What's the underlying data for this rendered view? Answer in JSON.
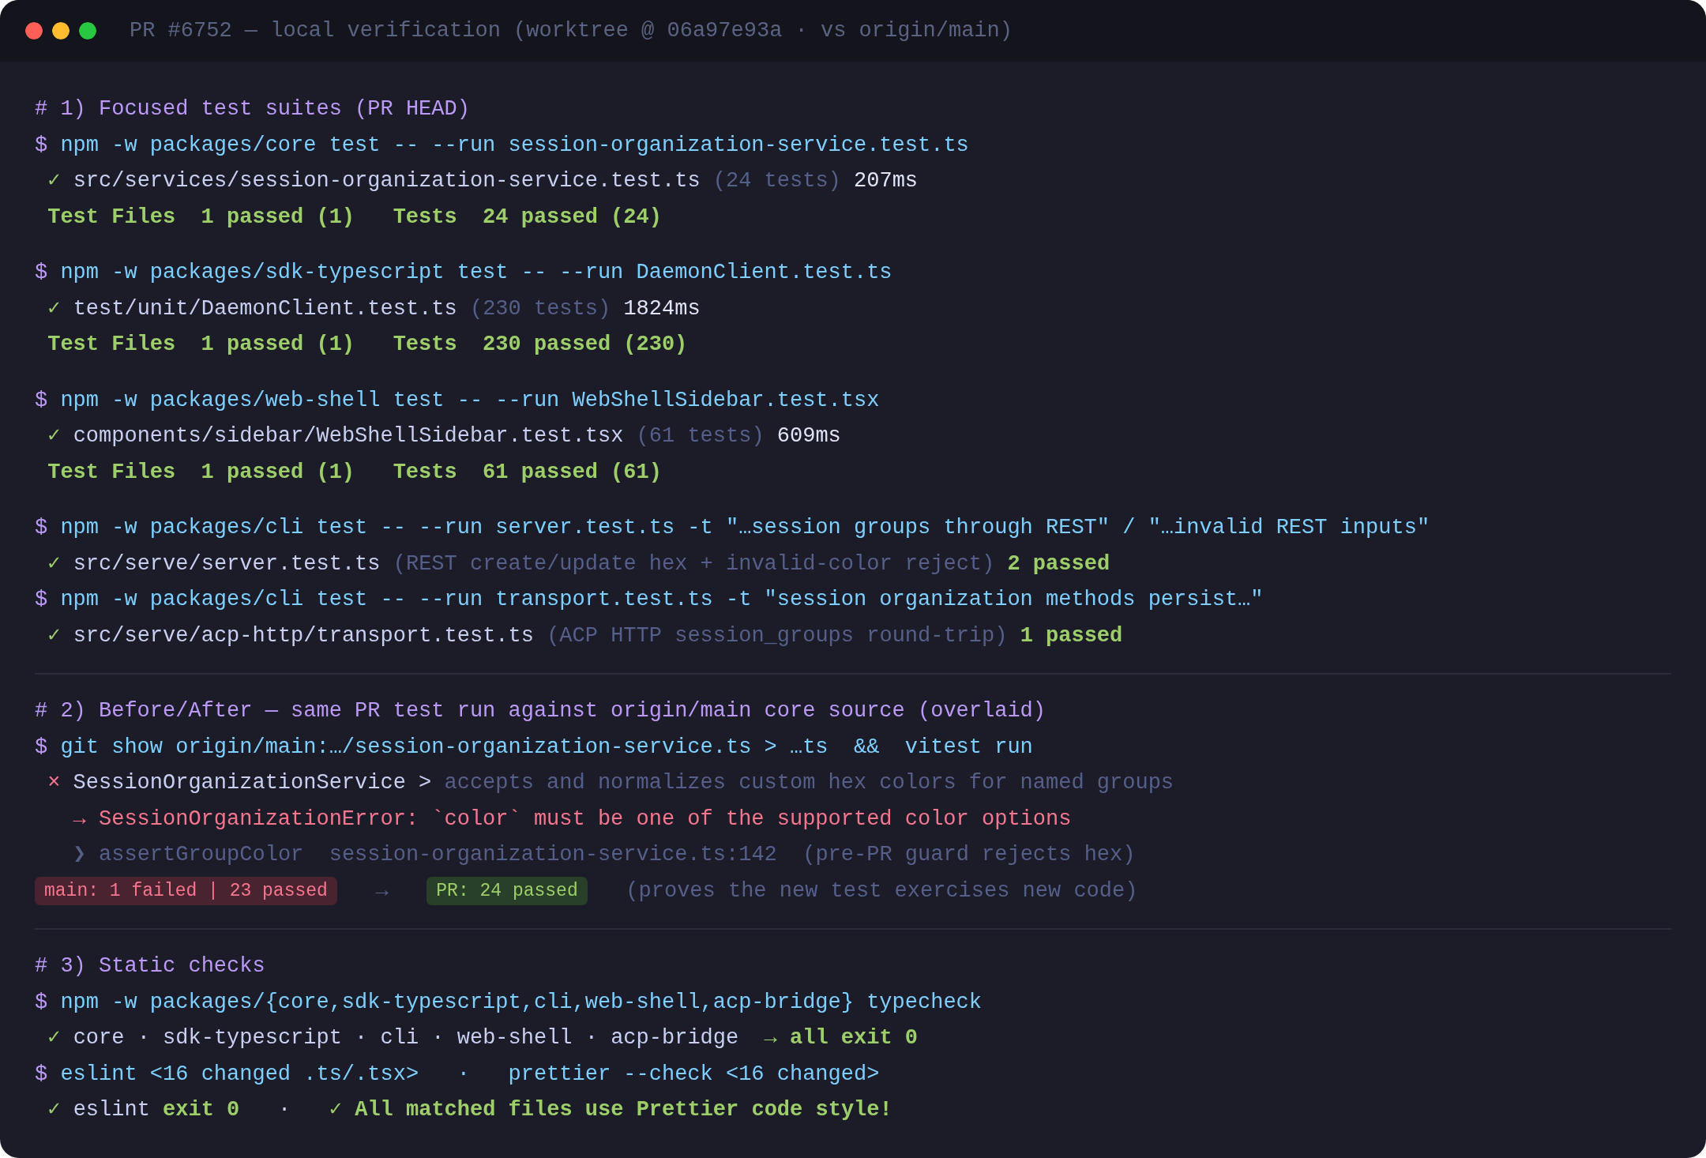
{
  "window": {
    "title": "PR #6752 — local verification (worktree @ 06a97e93a · vs origin/main)"
  },
  "sections": [
    {
      "blocks": [
        {
          "lines": [
            {
              "kind": "command",
              "segments": [
                {
                  "kind": "comment",
                  "text": "# 1) Focused test suites (PR HEAD)"
                }
              ]
            },
            {
              "kind": "command",
              "segments": [
                {
                  "kind": "prompt",
                  "text": "$"
                },
                {
                  "kind": "cmd",
                  "text": " npm -w packages/core test -- --run session-organization-service.test.ts"
                }
              ]
            },
            {
              "kind": "result",
              "segments": [
                {
                  "kind": "check",
                  "text": "✓"
                },
                {
                  "kind": "path",
                  "text": " src/services/session-organization-service.test.ts"
                },
                {
                  "kind": "muted",
                  "text": " (24 tests)"
                },
                {
                  "kind": "timing",
                  "text": " 207ms"
                }
              ]
            },
            {
              "kind": "result",
              "segments": [
                {
                  "kind": "pass",
                  "text": "Test Files  1 passed (1)   Tests  24 passed (24)"
                }
              ]
            }
          ]
        },
        {
          "lines": [
            {
              "kind": "command",
              "segments": [
                {
                  "kind": "prompt",
                  "text": "$"
                },
                {
                  "kind": "cmd",
                  "text": " npm -w packages/sdk-typescript test -- --run DaemonClient.test.ts"
                }
              ]
            },
            {
              "kind": "result",
              "segments": [
                {
                  "kind": "check",
                  "text": "✓"
                },
                {
                  "kind": "path",
                  "text": " test/unit/DaemonClient.test.ts"
                },
                {
                  "kind": "muted",
                  "text": " (230 tests)"
                },
                {
                  "kind": "timing",
                  "text": " 1824ms"
                }
              ]
            },
            {
              "kind": "result",
              "segments": [
                {
                  "kind": "pass",
                  "text": "Test Files  1 passed (1)   Tests  230 passed (230)"
                }
              ]
            }
          ]
        },
        {
          "lines": [
            {
              "kind": "command",
              "segments": [
                {
                  "kind": "prompt",
                  "text": "$"
                },
                {
                  "kind": "cmd",
                  "text": " npm -w packages/web-shell test -- --run WebShellSidebar.test.tsx"
                }
              ]
            },
            {
              "kind": "result",
              "segments": [
                {
                  "kind": "check",
                  "text": "✓"
                },
                {
                  "kind": "path",
                  "text": " components/sidebar/WebShellSidebar.test.tsx"
                },
                {
                  "kind": "muted",
                  "text": " (61 tests)"
                },
                {
                  "kind": "timing",
                  "text": " 609ms"
                }
              ]
            },
            {
              "kind": "result",
              "segments": [
                {
                  "kind": "pass",
                  "text": "Test Files  1 passed (1)   Tests  61 passed (61)"
                }
              ]
            }
          ]
        },
        {
          "lines": [
            {
              "kind": "command",
              "segments": [
                {
                  "kind": "prompt",
                  "text": "$"
                },
                {
                  "kind": "cmd",
                  "text": " npm -w packages/cli test -- --run server.test.ts -t \"…session groups through REST\" / \"…invalid REST inputs\""
                }
              ]
            },
            {
              "kind": "result",
              "segments": [
                {
                  "kind": "check",
                  "text": "✓"
                },
                {
                  "kind": "path",
                  "text": " src/serve/server.test.ts"
                },
                {
                  "kind": "muted",
                  "text": " (REST create/update hex + invalid-color reject)"
                },
                {
                  "kind": "pass",
                  "text": " 2 passed"
                }
              ]
            },
            {
              "kind": "command",
              "segments": [
                {
                  "kind": "prompt",
                  "text": "$"
                },
                {
                  "kind": "cmd",
                  "text": " npm -w packages/cli test -- --run transport.test.ts -t \"session organization methods persist…\""
                }
              ]
            },
            {
              "kind": "result",
              "segments": [
                {
                  "kind": "check",
                  "text": "✓"
                },
                {
                  "kind": "path",
                  "text": " src/serve/acp-http/transport.test.ts"
                },
                {
                  "kind": "muted",
                  "text": " (ACP HTTP session_groups round-trip)"
                },
                {
                  "kind": "pass",
                  "text": " 1 passed"
                }
              ]
            }
          ]
        }
      ]
    },
    {
      "blocks": [
        {
          "lines": [
            {
              "kind": "command",
              "segments": [
                {
                  "kind": "comment",
                  "text": "# 2) Before/After — same PR test run against origin/main core source (overlaid)"
                }
              ]
            },
            {
              "kind": "command",
              "segments": [
                {
                  "kind": "prompt",
                  "text": "$"
                },
                {
                  "kind": "cmd",
                  "text": " git show origin/main:…/session-organization-service.ts > …ts  &&  vitest run"
                }
              ]
            },
            {
              "kind": "result",
              "segments": [
                {
                  "kind": "cross",
                  "text": "×"
                },
                {
                  "kind": "path",
                  "text": " SessionOrganizationService >"
                },
                {
                  "kind": "muted",
                  "text": " accepts and normalizes custom hex colors for named groups"
                }
              ]
            },
            {
              "kind": "detail",
              "segments": [
                {
                  "kind": "error",
                  "text": "→ SessionOrganizationError: `color` must be one of the supported color options"
                }
              ]
            },
            {
              "kind": "detail",
              "segments": [
                {
                  "kind": "muted",
                  "text": "❯ assertGroupColor  session-organization-service.ts:142  (pre-PR guard rejects hex)"
                }
              ]
            },
            {
              "kind": "command",
              "segments": [
                {
                  "kind": "badge_fail",
                  "text": "main: 1 failed | 23 passed"
                },
                {
                  "kind": "muted",
                  "text": "   →   "
                },
                {
                  "kind": "badge_pass",
                  "text": "PR: 24 passed"
                },
                {
                  "kind": "muted",
                  "text": "   (proves the new test exercises new code)"
                }
              ]
            }
          ]
        }
      ]
    },
    {
      "blocks": [
        {
          "lines": [
            {
              "kind": "command",
              "segments": [
                {
                  "kind": "comment",
                  "text": "# 3) Static checks"
                }
              ]
            },
            {
              "kind": "command",
              "segments": [
                {
                  "kind": "prompt",
                  "text": "$"
                },
                {
                  "kind": "cmd",
                  "text": " npm -w packages/{core,sdk-typescript,cli,web-shell,acp-bridge} typecheck"
                }
              ]
            },
            {
              "kind": "result",
              "segments": [
                {
                  "kind": "check",
                  "text": "✓"
                },
                {
                  "kind": "path",
                  "text": " core · sdk-typescript · cli · web-shell · acp-bridge  "
                },
                {
                  "kind": "pass",
                  "text": "→ all exit 0"
                }
              ]
            },
            {
              "kind": "command",
              "segments": [
                {
                  "kind": "prompt",
                  "text": "$"
                },
                {
                  "kind": "cmd",
                  "text": " eslint <16 changed .ts/.tsx>   ·   prettier --check <16 changed>"
                }
              ]
            },
            {
              "kind": "result",
              "segments": [
                {
                  "kind": "check",
                  "text": "✓"
                },
                {
                  "kind": "path",
                  "text": " eslint "
                },
                {
                  "kind": "pass",
                  "text": "exit 0"
                },
                {
                  "kind": "path",
                  "text": "   ·   "
                },
                {
                  "kind": "check",
                  "text": "✓"
                },
                {
                  "kind": "pass",
                  "text": " All matched files use Prettier code style!"
                }
              ]
            }
          ]
        }
      ]
    }
  ]
}
